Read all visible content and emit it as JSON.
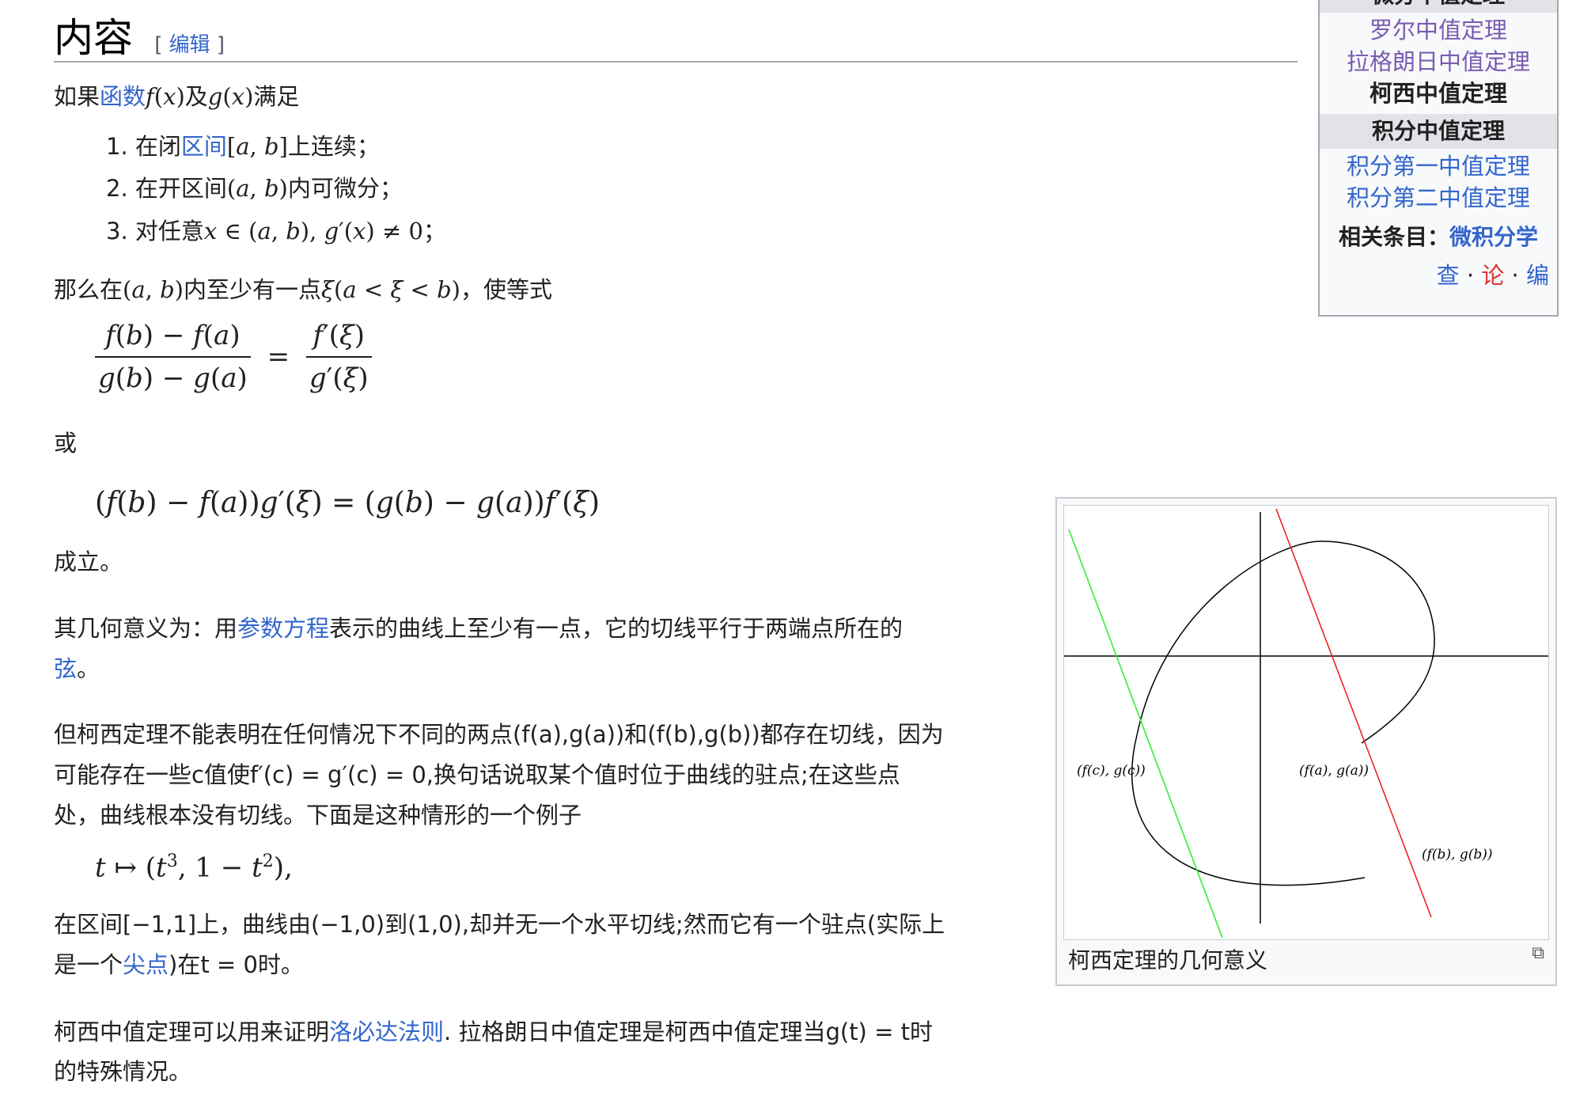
{
  "heading": {
    "title": "内容",
    "edit_label": "编辑"
  },
  "theorem": {
    "intro": {
      "pre": "如果",
      "link": "函数",
      "mid": "及",
      "post": "满足"
    },
    "conditions": [
      {
        "num": "1.",
        "pre": "在闭",
        "link": "区间",
        "post": "上连续；"
      },
      {
        "num": "2.",
        "text": "在开区间",
        "post": "内可微分；"
      },
      {
        "num": "3.",
        "text": "对任意",
        "post": "；"
      }
    ],
    "conclusion": {
      "pre": "那么在",
      "mid": "内至少有一点",
      "post": "，使等式"
    },
    "or_label": "或",
    "holds_label": "成立。"
  },
  "geometry_paragraph": {
    "pre": "其几何意义为：用",
    "link": "参数方程",
    "post": "表示的曲线上至少有一点，它的切线平行于两端点所在的",
    "link2": "弦",
    "end": "。"
  },
  "caveat_paragraph": {
    "line1": "但柯西定理不能表明在任何情况下不同的两点(f(a),g(a))和(f(b),g(b))都存在切线，因为",
    "line2": "可能存在一些c值使f′(c) = g′(c) = 0,换句话说取某个值时位于曲线的驻点;在这些点",
    "line3": "处，曲线根本没有切线。下面是这种情形的一个例子"
  },
  "example_paragraph": {
    "line1": "在区间[−1,1]上，曲线由(−1,0)到(1,0),却并无一个水平切线;然而它有一个驻点(实际上",
    "line2_pre": "是一个",
    "line2_link": "尖点",
    "line2_post": ")在t = 0时。"
  },
  "lhopital_paragraph": {
    "pre": "柯西中值定理可以用来证明",
    "link": "洛必达法则",
    "post": ". 拉格朗日中值定理是柯西中值定理当g(t) = t时",
    "line2": "的特殊情况。"
  },
  "navbox": {
    "group_top": "微分中值定理",
    "differential_items": [
      "罗尔中值定理",
      "拉格朗日中值定理",
      "柯西中值定理"
    ],
    "group_integral": "积分中值定理",
    "integral_items": [
      "积分第一中值定理",
      "积分第二中值定理"
    ],
    "related_label": "相关条目：",
    "related_link": "微积分学",
    "view": "查",
    "talk": "论",
    "edit": "编",
    "sep": "·"
  },
  "figure": {
    "caption": "柯西定理的几何意义",
    "labels": {
      "c": "(f(c), g(c))",
      "a": "(f(a), g(a))",
      "b": "(f(b), g(b))"
    },
    "colors": {
      "tangent": "#33ee33",
      "chord": "#ee2222",
      "curve": "#000000"
    }
  }
}
